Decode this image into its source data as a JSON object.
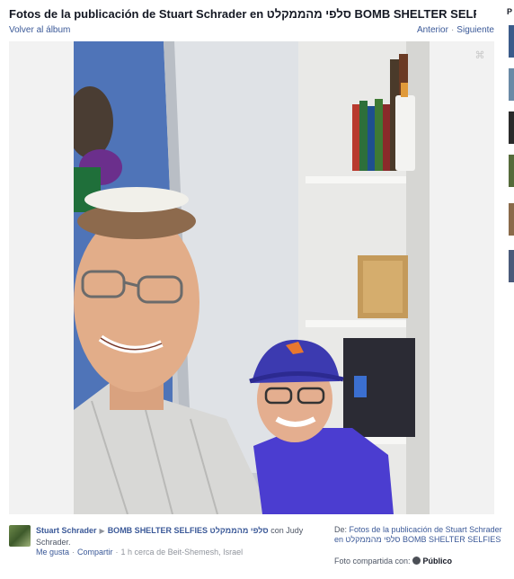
{
  "header": {
    "title": "Fotos de la publicación de Stuart Schrader en סלפי מהממקלט BOMB SHELTER SELFIES",
    "back_label": "Volver al álbum",
    "prev_label": "Anterior",
    "next_label": "Siguiente",
    "separator": "·"
  },
  "right_strip": {
    "label": "P"
  },
  "footer": {
    "poster_name": "Stuart Schrader",
    "arrow": "▶",
    "album_name": "BOMB SHELTER SELFIES סלפי מהממקלט",
    "with_text": "con Judy Schrader.",
    "like_label": "Me gusta",
    "share_label": "Compartir",
    "meta": "1 h cerca de Beit-Shemesh, Israel",
    "from_prefix": "De:",
    "from_album": "Fotos de la publicación de Stuart Schrader en סלפי מהממקלט BOMB SHELTER SELFIES",
    "shared_with_label": "Foto compartida con:",
    "audience": "Público"
  },
  "colors": {
    "link": "#3b5998",
    "muted": "#90949c",
    "text": "#141823"
  }
}
